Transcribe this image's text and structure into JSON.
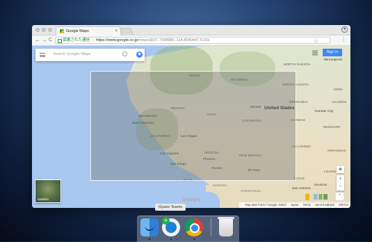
{
  "browser": {
    "tab_title": "Google Maps",
    "tab_close": "×",
    "secure_label": "保護された通信",
    "url_host": "https://www.google.co.jp",
    "url_path": "/maps/@37.7008989,-114.8640447,5.03z",
    "nav_back": "←",
    "nav_forward": "→",
    "nav_reload": "C",
    "star": "☆",
    "menu": "⋮"
  },
  "maps": {
    "search_placeholder": "Search Google Maps",
    "directions_glyph": "◆",
    "sign_in": "Sign in",
    "satellite_label": "Satellite",
    "google_logo": "Google",
    "zoom_in": "+",
    "zoom_out": "−",
    "compass": "◈",
    "expand": "⌃",
    "attribution": [
      "Map data ©2017 Google, INEGI",
      "Japan",
      "Terms",
      "Send feedback",
      "200 km"
    ],
    "labels": {
      "north_dakota": "NORTH DAKOTA",
      "minneapolis": "Minneapolis",
      "idaho": "IDAHO",
      "wyoming": "WYOMING",
      "south_dakota": "SOUTH DAKOTA",
      "nevada": "NEVADA",
      "utah": "UTAH",
      "denver": "Denver",
      "united_states": "United States",
      "kansas_city": "Kansas City",
      "sacramento": "Sacramento",
      "san_francisco": "San Francisco",
      "colorado": "COLORADO",
      "kansas": "KANSAS",
      "california": "CALIFORNIA",
      "las_vegas": "Las Vegas",
      "missouri": "MISSOURI",
      "los_angeles": "Los Angeles",
      "arizona": "ARIZONA",
      "new_mexico": "NEW MEXICO",
      "arkansas": "ARKANSAS",
      "phoenix": "Phoenix",
      "san_diego": "San Diego",
      "tucson": "Tucson",
      "el_paso": "El Paso",
      "baja": "BAJA",
      "sonora": "SONORA",
      "chihuahua": "CHIHUAHUA",
      "texas": "TEXAS",
      "san_antonio": "San Antonio",
      "houston": "Houston",
      "louisiana": "LOUISIANA",
      "iowa": "IOWA",
      "nebraska": "NEBRASKA",
      "illinois": "ILLINOIS",
      "oklahoma": "OKLAHOMA"
    }
  },
  "dock": {
    "tooltip": "Gyazo Teams"
  }
}
